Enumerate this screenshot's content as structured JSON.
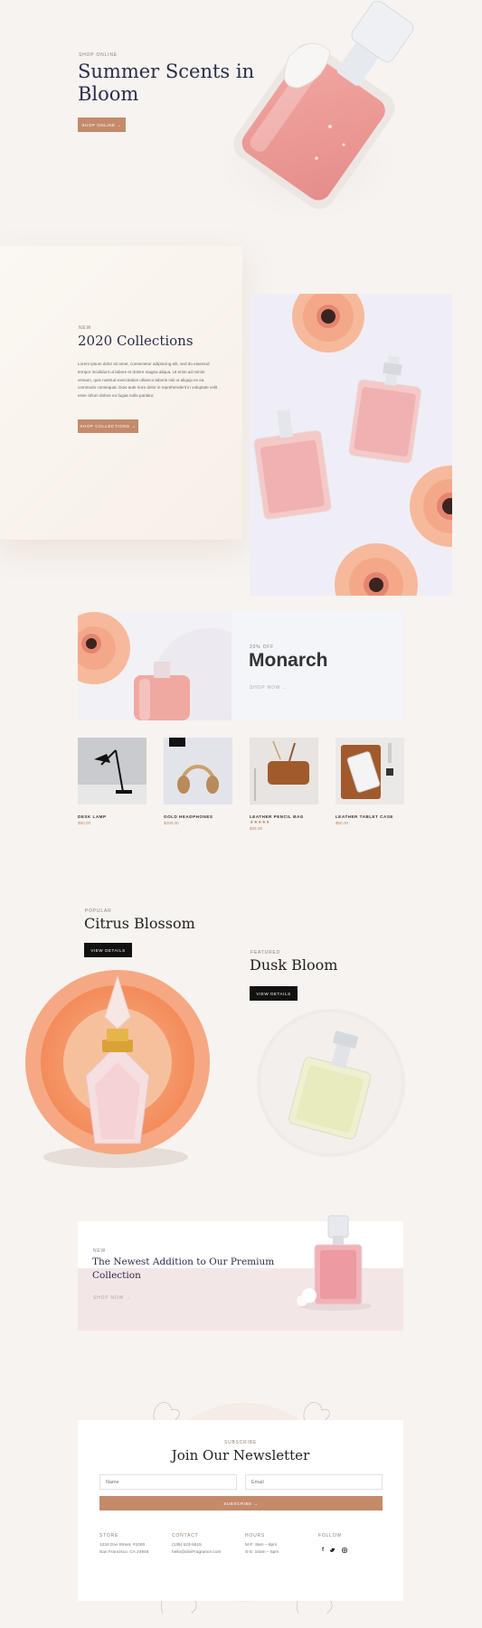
{
  "colors": {
    "accent": "#c48a6a",
    "dark": "#111111",
    "bg": "#f6f3f0"
  },
  "hero": {
    "eyebrow": "SHOP ONLINE",
    "title_line1": "Summer Scents in",
    "title_line2": "Bloom",
    "button": "SHOP ONLINE →"
  },
  "collections": {
    "eyebrow": "NEW",
    "title": "2020 Collections",
    "body": "Lorem ipsum dolor sit amet, consectetur adipiscing elit, sed do eiusmod tempor incididunt ut labore et dolore magna aliqua. Ut enim ad minim veniam, quis nostrud exercitation ullamco laboris nisi ut aliquip ex ea commodo consequat. Duis aute irure dolor in reprehenderit in voluptate velit esse cillum dolore eu fugiat nulla pariatur.",
    "button": "SHOP COLLECTIONS →"
  },
  "monarch": {
    "eyebrow": "20% OFF",
    "title": "Monarch",
    "link": "SHOP NOW →"
  },
  "products": [
    {
      "name": "DESK LAMP",
      "price": "$50.00",
      "rating": ""
    },
    {
      "name": "GOLD HEADPHONES",
      "price": "$200.00",
      "rating": ""
    },
    {
      "name": "LEATHER PENCIL BAG",
      "price": "$35.00",
      "rating": "★★★★★"
    },
    {
      "name": "LEATHER TABLET CASE",
      "price": "$60.00",
      "rating": ""
    }
  ],
  "citrus": {
    "eyebrow": "POPULAR",
    "title": "Citrus Blossom",
    "button": "VIEW DETAILS"
  },
  "dusk": {
    "eyebrow": "FEATURED",
    "title": "Dusk Bloom",
    "button": "VIEW DETAILS"
  },
  "premium": {
    "eyebrow": "NEW",
    "title_line1": "The Newest Addition to Our Premium",
    "title_line2": "Collection",
    "link": "SHOP NOW →"
  },
  "newsletter": {
    "eyebrow": "SUBSCRIBE",
    "title": "Join Our Newsletter",
    "name_placeholder": "Name",
    "email_placeholder": "Email",
    "button": "SUBSCRIBE →"
  },
  "footer": {
    "store": {
      "heading": "STORE",
      "line1": "1234 Divi Street, #1000",
      "line2": "San Francisco, CA 24948"
    },
    "contact": {
      "heading": "CONTACT",
      "line1": "(135) 523-5515",
      "line2": "hello@diviFragrance.com"
    },
    "hours": {
      "heading": "HOURS",
      "line1": "M-F: 9am – 6pm",
      "line2": "S-S: 10am – 5pm"
    },
    "follow": {
      "heading": "FOLLOW",
      "icons": [
        "facebook-icon",
        "twitter-icon",
        "instagram-icon"
      ]
    }
  }
}
